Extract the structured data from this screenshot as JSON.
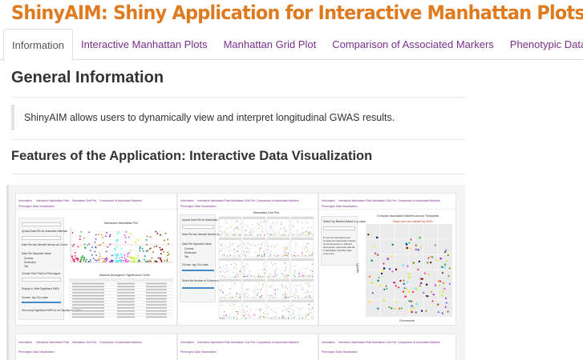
{
  "app": {
    "title": "ShinyAIM: Shiny Application for Interactive Manhattan Plots"
  },
  "tabs": [
    {
      "label": "Information",
      "active": true
    },
    {
      "label": "Interactive Manhattan Plots",
      "active": false
    },
    {
      "label": "Manhattan Grid Plot",
      "active": false
    },
    {
      "label": "Comparison of Associated Markers",
      "active": false
    },
    {
      "label": "Phenotypic Data Visualization",
      "active": false
    }
  ],
  "main": {
    "heading": "General Information",
    "description": "ShinyAIM allows users to dynamically view and interpret longitudinal GWAS results.",
    "features_heading": "Features of the Application: Interactive Data Visualization"
  },
  "thumbnails": {
    "nav_labels": [
      "Information",
      "Interactive Manhattan Plots",
      "Manhattan Grid Plot",
      "Comparison of Associated Markers"
    ],
    "nav_row2": "Phenotypic Data Visualization",
    "shot1": {
      "panel_labels": [
        "Upload Data File for Interactive Manhattan Plots",
        "Data File has Variable Names as Column Headers",
        "Data File Separator Value:",
        "Comma",
        "Semicolon",
        "Tab",
        "Choose Time Point or Phenotypes",
        "Display in Table Significant SNPs",
        "Choose -log 10 p-value",
        "How many Significant SNPs to be Displayed in Table"
      ],
      "plot_title": "Interactive Manhattan Plot",
      "table_title": "Markers Arranged in Significance Order"
    },
    "shot2": {
      "panel_labels": [
        "Upload Data File for Manhattan Grid Plots",
        "Data File has Variable Names as Column Headers",
        "Data File Separator Value:",
        "Comma",
        "Semicolon",
        "Tab",
        "Choose -log 10 p-value",
        "Select the Number of Columns for Grid Plot"
      ],
      "plot_title": "Manhattan Grid Plot"
    },
    "shot3": {
      "panel_labels": [
        "Select Top Markers Based on p-value",
        "To see the interactions and compare the associated markers across timepoints or different phenotypes, upload the data file in Manhattan Grid Plots data screen first."
      ],
      "plot_title": "Compare Associated Markers Across Timepoints",
      "subtitle": "Shape and color indicate top SNPs",
      "ylabel": "-log10(P)",
      "xlabel": "Chromosome"
    },
    "colors": [
      "#e6194b",
      "#3cb44b",
      "#4363d8",
      "#f58231",
      "#911eb4",
      "#46f0f0",
      "#f032e6",
      "#bcf60c",
      "#008080",
      "#9a6324",
      "#800000",
      "#808000",
      "#000075",
      "#ffe119"
    ]
  }
}
